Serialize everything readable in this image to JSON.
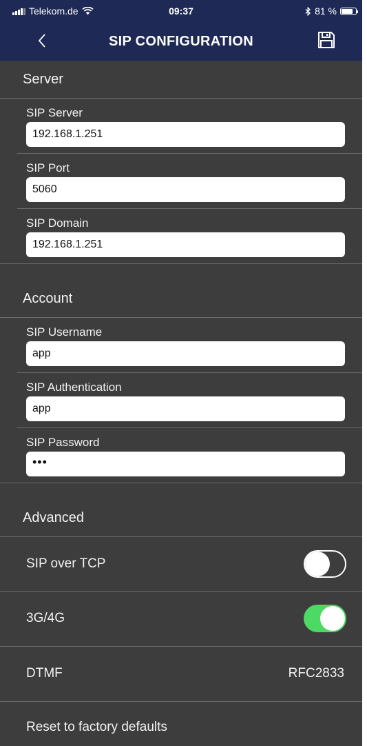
{
  "status_bar": {
    "carrier": "Telekom.de",
    "time": "09:37",
    "battery_percent": "81 %",
    "battery_level": 0.81,
    "icons": [
      "signal-icon",
      "wifi-icon",
      "bluetooth-icon",
      "battery-icon"
    ]
  },
  "nav": {
    "title": "SIP CONFIGURATION",
    "back_icon": "chevron-left-icon",
    "save_icon": "save-icon"
  },
  "sections": {
    "server": "Server",
    "account": "Account",
    "advanced": "Advanced"
  },
  "fields": {
    "sip_server": {
      "label": "SIP Server",
      "value": "192.168.1.251"
    },
    "sip_port": {
      "label": "SIP Port",
      "value": "5060"
    },
    "sip_domain": {
      "label": "SIP Domain",
      "value": "192.168.1.251"
    },
    "sip_username": {
      "label": "SIP Username",
      "value": "app"
    },
    "sip_authentication": {
      "label": "SIP Authentication",
      "value": "app"
    },
    "sip_password": {
      "label": "SIP Password",
      "masked_value": "•••"
    }
  },
  "advanced": {
    "sip_over_tcp": {
      "label": "SIP over TCP",
      "enabled": false
    },
    "mobile_data": {
      "label": "3G/4G",
      "enabled": true
    },
    "dtmf": {
      "label": "DTMF",
      "value": "RFC2833"
    },
    "reset": {
      "label": "Reset to factory defaults"
    }
  },
  "colors": {
    "nav_background": "#1e2a55",
    "content_background": "#3d3d3d",
    "toggle_on": "#4cd964",
    "separator": "#6a6a6a"
  }
}
